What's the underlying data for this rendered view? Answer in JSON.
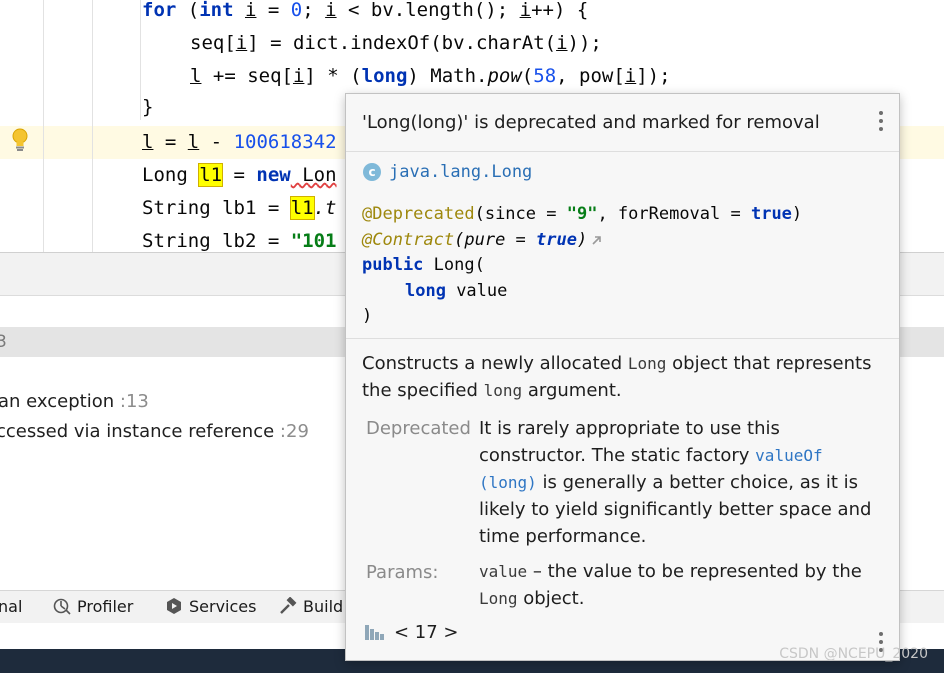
{
  "editor": {
    "code_tokens": {
      "for": "for",
      "int": "int",
      "i": "i",
      "eq0": " = ",
      "zero": "0",
      "semi_i": "; ",
      "lt_bv": " < bv.length(); ",
      "inc": "++) {",
      "seq": "seq[",
      "dict": "] = dict.indexOf(bv.charAt(",
      "close1": "));",
      "l": "l",
      "pluseq": " += seq[",
      "times": "] * (",
      "long": "long",
      "math": ") Math.",
      "pow": "pow",
      "p58": "(",
      "n58": "58",
      "powi": ", pow[",
      "close2": "]);",
      "brace": "}",
      "l_assign": " = ",
      "minus": " - ",
      "num_long": "100618342",
      "Long": "Long ",
      "l1": "l1",
      "eq_new": " = ",
      "new": "new",
      "lon": " Lon",
      "String": "String lb1 = ",
      "l1b": "l1",
      "dot_t": ".t",
      "String2": "String lb2 = ",
      "str101": "\"101"
    }
  },
  "problems": {
    "group_count": "3",
    "issues": [
      {
        "text": "an exception",
        "line": ":13"
      },
      {
        "text": "ccessed via instance reference",
        "line": ":29"
      }
    ]
  },
  "toolbar": {
    "items": [
      {
        "label": "nal",
        "icon": "terminal-icon"
      },
      {
        "label": "Profiler",
        "icon": "profiler-icon"
      },
      {
        "label": "Services",
        "icon": "services-icon"
      },
      {
        "label": "Build",
        "icon": "build-hammer-icon"
      }
    ]
  },
  "popup": {
    "title": "'Long(long)' is deprecated and marked for removal",
    "package": "java.lang.Long",
    "badge": "c",
    "signature": {
      "ann1": "@Deprecated",
      "ann1_open": "(since = ",
      "since": "\"9\"",
      "ann1_mid": ", forRemoval = ",
      "ann1_true": "true",
      "ann1_close": ")",
      "ann2": "@Contract",
      "ann2_open": "(pure = ",
      "ann2_true": "true",
      "ann2_close": ")",
      "public": "public",
      "ctor": " Long(",
      "long": "long",
      "param": " value",
      "close": ")"
    },
    "description": {
      "p1": "Constructs a newly allocated ",
      "c1": "Long",
      "p2": " object that represents the specified ",
      "c2": "long",
      "p3": " argument."
    },
    "deprecated": {
      "label": "Deprecated",
      "t1": "It is rarely appropriate to use this constructor. The static factory ",
      "link1": "valueOf",
      "link2": "(long)",
      "t2": " is generally a better choice, as it is likely to yield significantly better space and time performance."
    },
    "params": {
      "label": "Params:",
      "code": "value",
      "t1": " – the value to be represented by the ",
      "code2": "Long",
      "t2": " object."
    },
    "footer": {
      "text": "< 17 >"
    }
  },
  "watermark": "CSDN @NCEPU_2020"
}
